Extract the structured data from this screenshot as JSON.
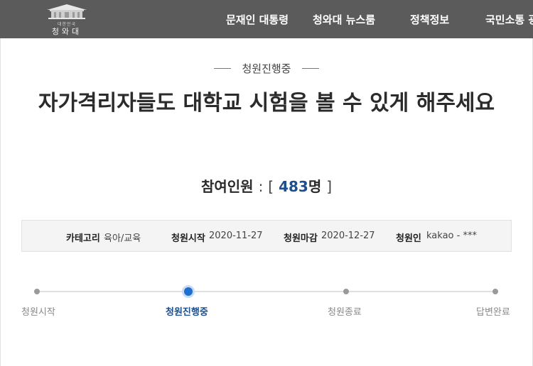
{
  "header": {
    "logo_small": "대한민국",
    "logo_main": "청와대",
    "nav": [
      "문재인 대통령",
      "청와대 뉴스룸",
      "정책정보",
      "국민소통 광장"
    ]
  },
  "petition": {
    "status": "청원진행중",
    "title": "자가격리자들도 대학교 시험을 볼 수 있게 해주세요",
    "count_label": "참여인원",
    "count_colon": ":",
    "count_open": "[",
    "count_value": "483",
    "count_unit": "명",
    "count_close": "]"
  },
  "info": {
    "category_label": "카테고리",
    "category_value": "육아/교육",
    "start_label": "청원시작",
    "start_value": "2020-11-27",
    "end_label": "청원마감",
    "end_value": "2020-12-27",
    "author_label": "청원인",
    "author_value": "kakao - ***"
  },
  "progress": {
    "steps": [
      "청원시작",
      "청원진행중",
      "청원종료",
      "답변완료"
    ],
    "current": "청원진행중"
  },
  "colors": {
    "header_bg": "#5b5b5b",
    "accent_blue": "#1c4f8c",
    "active_dot": "#1e6fd0"
  }
}
